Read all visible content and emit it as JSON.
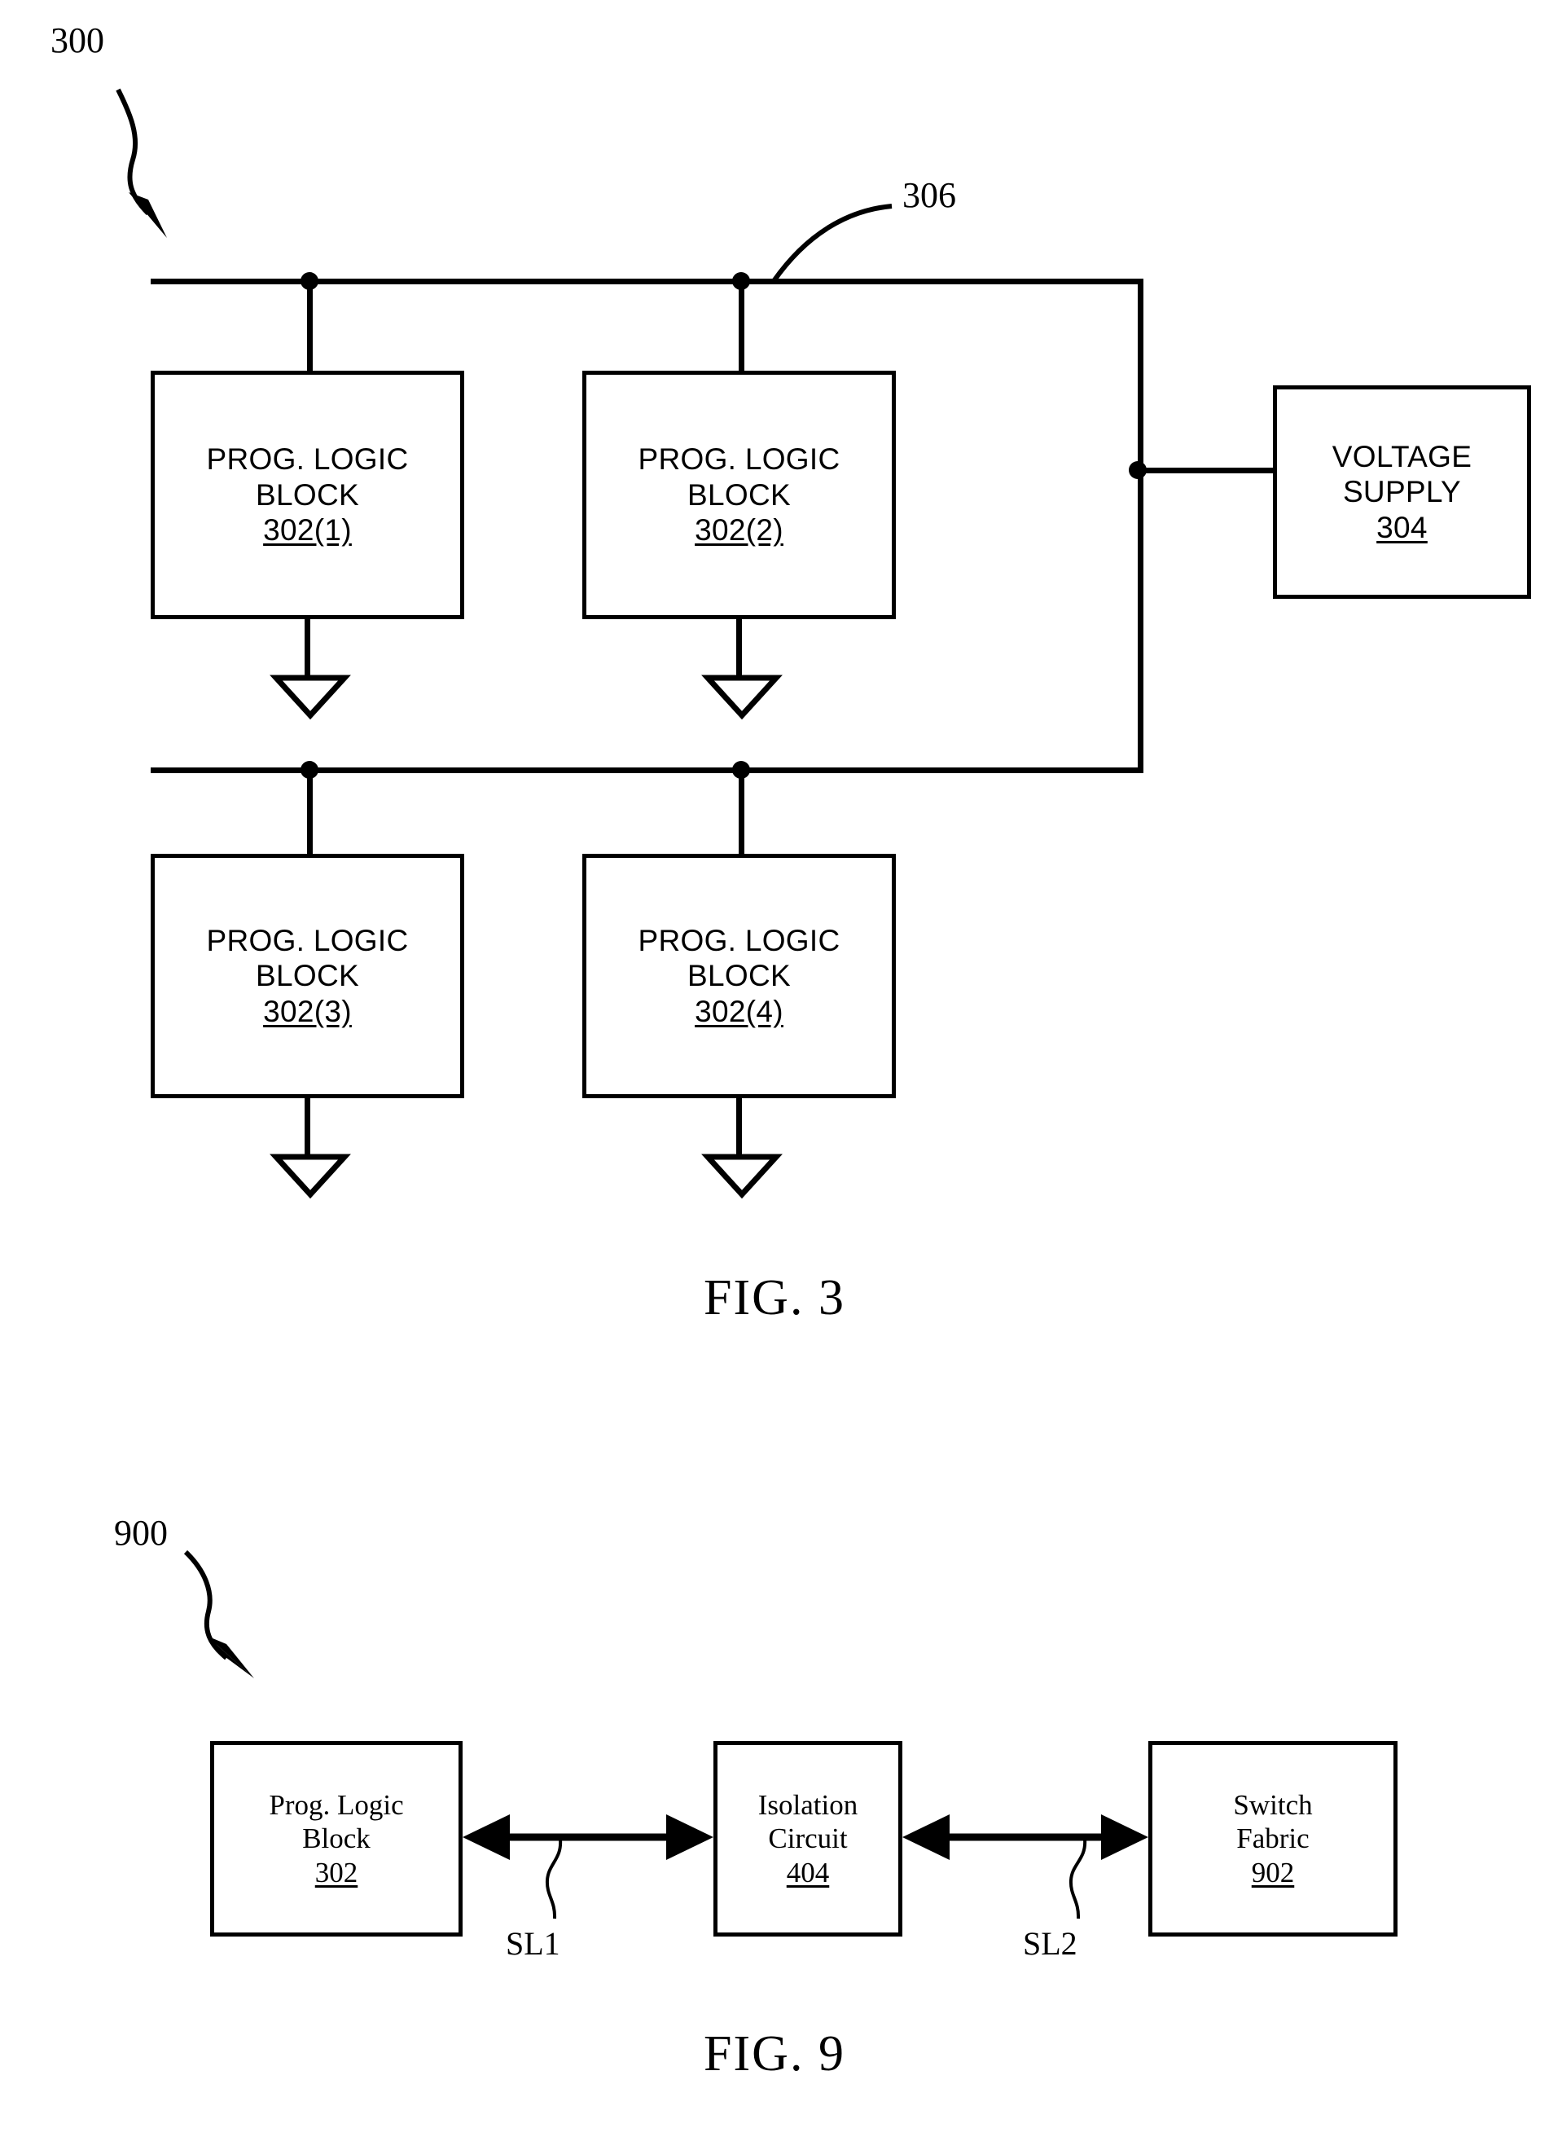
{
  "figures": [
    {
      "id": "fig3",
      "caption": "FIG. 3",
      "ref_label": "300",
      "bus_label": "306",
      "voltage_supply": {
        "line1": "VOLTAGE",
        "line2": "SUPPLY",
        "ref": "304"
      },
      "blocks": [
        {
          "line1": "PROG. LOGIC",
          "line2": "BLOCK",
          "ref": "302(1)"
        },
        {
          "line1": "PROG. LOGIC",
          "line2": "BLOCK",
          "ref": "302(2)"
        },
        {
          "line1": "PROG. LOGIC",
          "line2": "BLOCK",
          "ref": "302(3)"
        },
        {
          "line1": "PROG. LOGIC",
          "line2": "BLOCK",
          "ref": "302(4)"
        }
      ]
    },
    {
      "id": "fig9",
      "caption": "FIG. 9",
      "ref_label": "900",
      "blocks": [
        {
          "line1": "Prog. Logic",
          "line2": "Block",
          "ref": "302"
        },
        {
          "line1": "Isolation",
          "line2": "Circuit",
          "ref": "404"
        },
        {
          "line1": "Switch",
          "line2": "Fabric",
          "ref": "902"
        }
      ],
      "signal_labels": [
        "SL1",
        "SL2"
      ]
    }
  ],
  "colors": {
    "ink": "#000000",
    "paper": "#ffffff"
  }
}
